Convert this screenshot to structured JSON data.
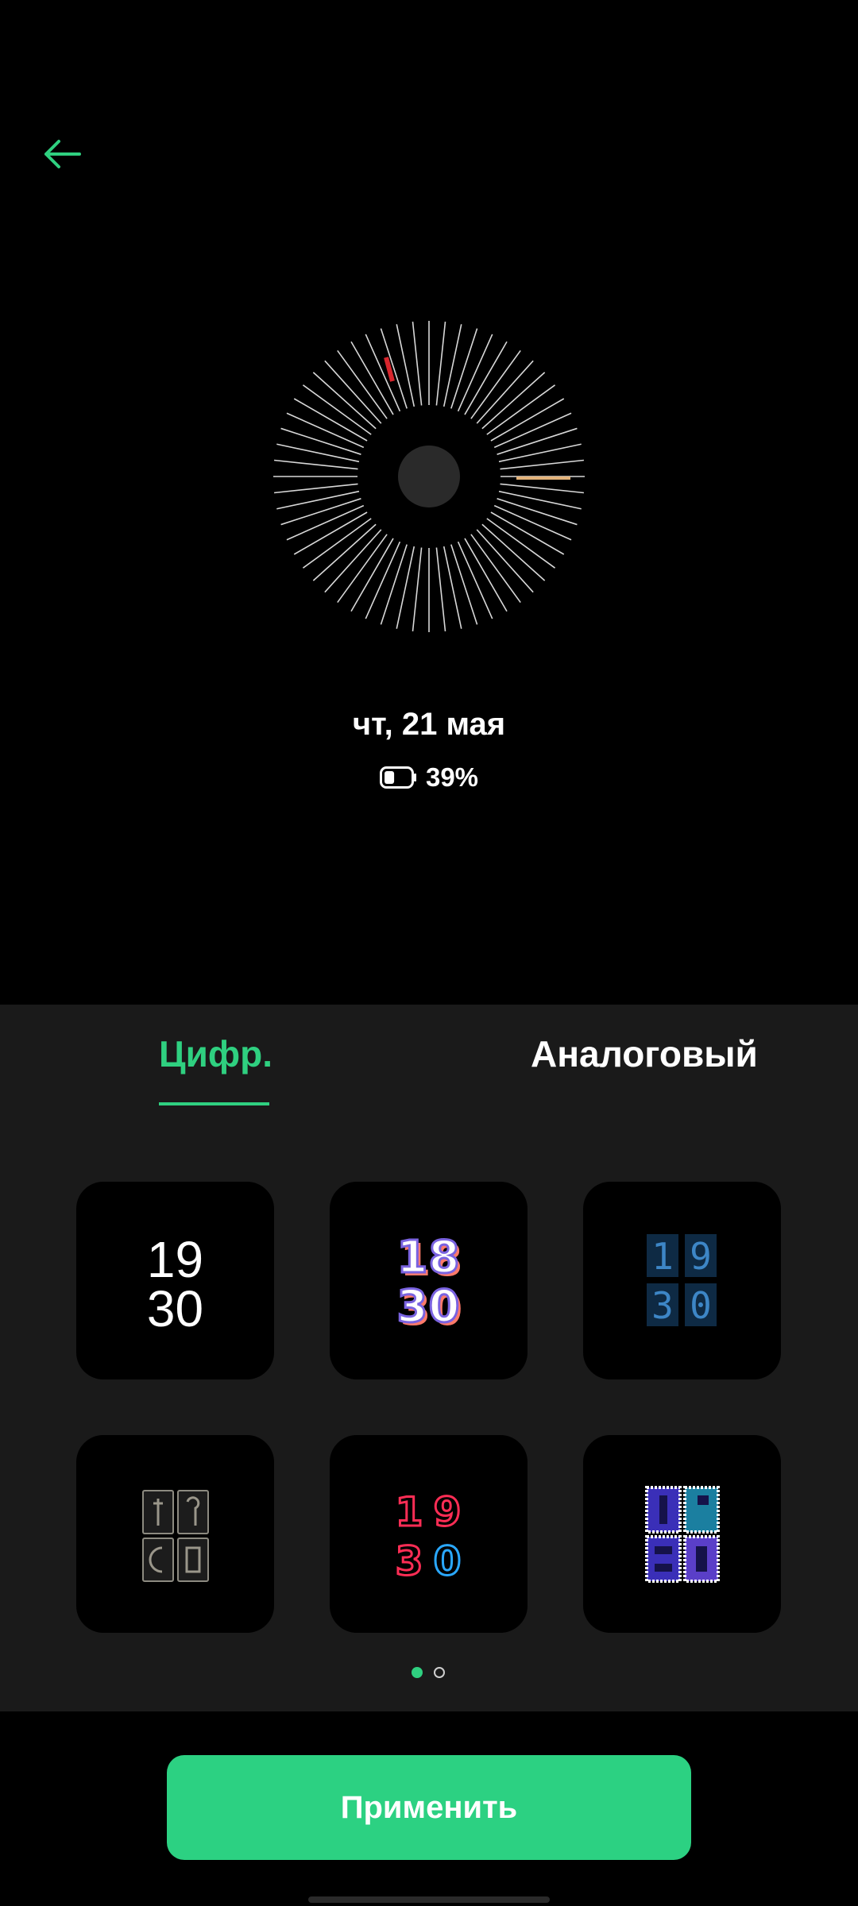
{
  "header": {
    "back_icon": "arrow-left-icon"
  },
  "preview": {
    "date": "чт, 21 мая",
    "battery_percent": "39%",
    "battery_level": 0.39
  },
  "tabs": [
    {
      "label": "Цифр.",
      "selected": true
    },
    {
      "label": "Аналоговый",
      "selected": false
    }
  ],
  "styles": [
    {
      "id": "minimal",
      "line1": "19",
      "line2": "30",
      "selected": true
    },
    {
      "id": "isometric",
      "line1": "18",
      "line2": "30"
    },
    {
      "id": "pixel-blue",
      "line1": "19",
      "line2": "30"
    },
    {
      "id": "tarot",
      "line1": "19",
      "line2": "30"
    },
    {
      "id": "neon",
      "line1": "19",
      "line2": "30"
    },
    {
      "id": "stamp",
      "line1": "19",
      "line2": "30"
    }
  ],
  "pager": {
    "current": 1,
    "total": 2
  },
  "apply_button": {
    "label": "Применить"
  },
  "colors": {
    "accent": "#2cd182",
    "panel": "#1a1a1a",
    "background": "#000000"
  }
}
